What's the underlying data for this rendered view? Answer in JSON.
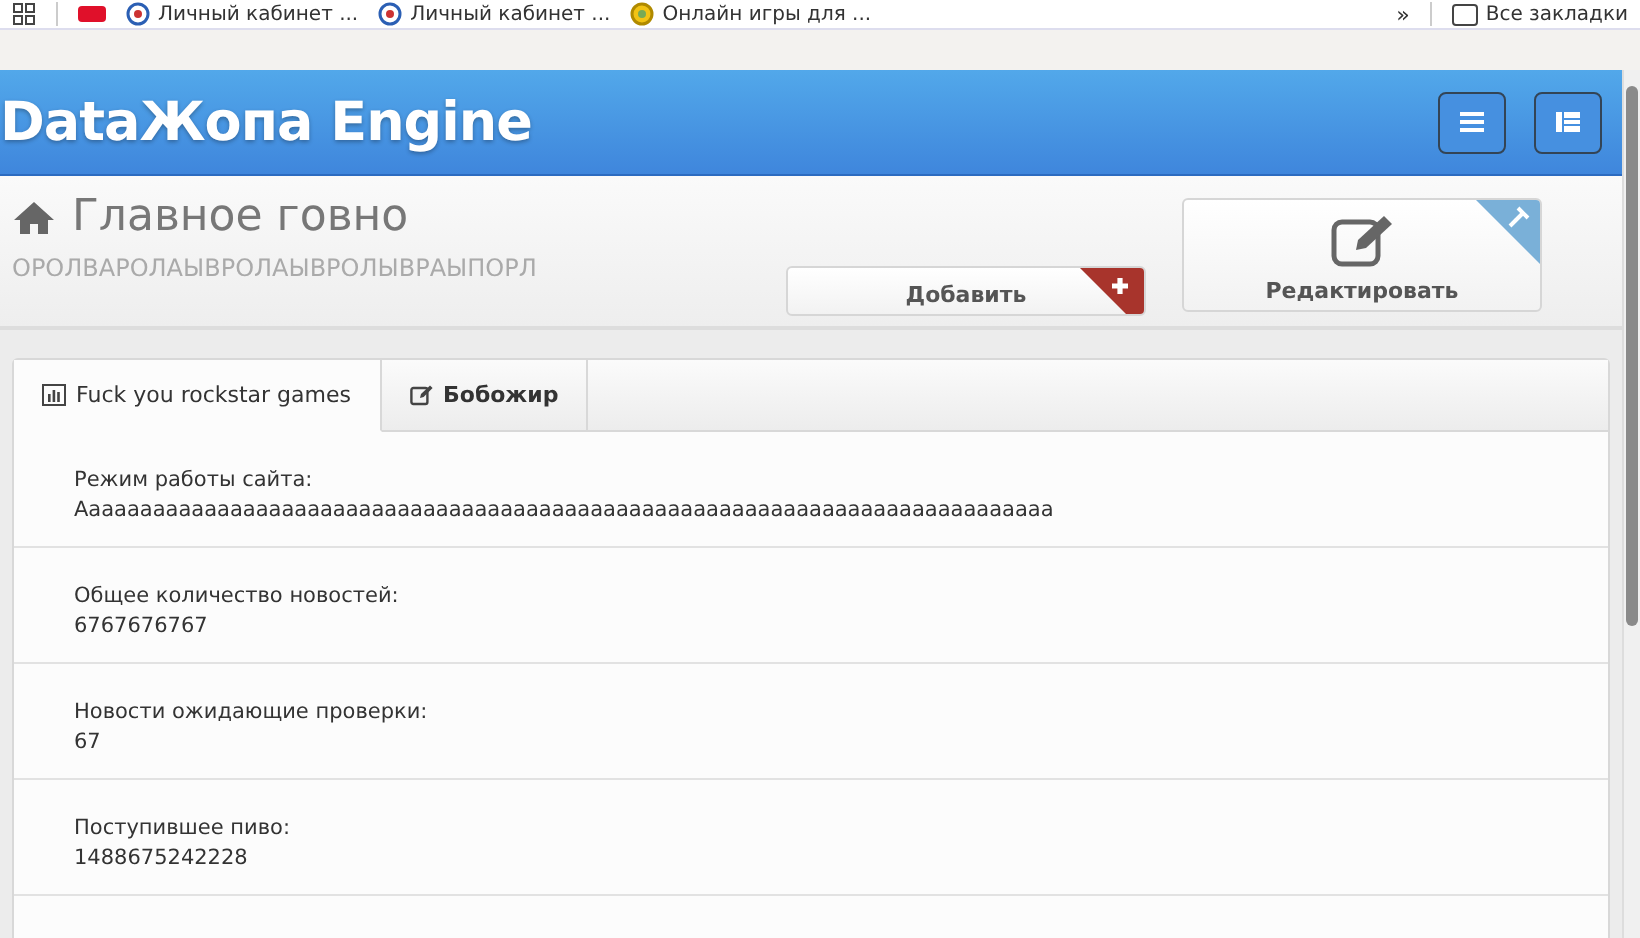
{
  "bookmarks_bar": {
    "items": [
      {
        "label": "Личный кабинет ..."
      },
      {
        "label": "Личный кабинет ..."
      },
      {
        "label": "Онлайн игры для ..."
      }
    ],
    "overflow": "»",
    "all_bookmarks": "Все закладки"
  },
  "header": {
    "title": "DataЖопа Engine"
  },
  "page_header": {
    "title": "Главное говно",
    "subtitle": "ОРОЛВАРОЛАЫВРОЛАЫВРОЛЫВРАЫПОРЛ",
    "actions": [
      {
        "label": "Добавить",
        "kind": "add"
      },
      {
        "label": "Редактировать",
        "kind": "edit"
      }
    ]
  },
  "tabs": [
    {
      "label": "Fuck you rockstar games",
      "kind": "chart",
      "selected": true
    },
    {
      "label": "Бобожир",
      "kind": "edit",
      "selected": false
    }
  ],
  "stats": [
    {
      "label": "Режим работы сайта:",
      "value": "Аааааааааааааааааааааааааааааааааааааааааааааааааааааааааааааааааааааааааааа"
    },
    {
      "label": "Общее количество новостей:",
      "value": "6767676767"
    },
    {
      "label": "Новости ожидающие проверки:",
      "value": "67"
    },
    {
      "label": "Поступившее пиво:",
      "value": "1488675242228"
    }
  ]
}
